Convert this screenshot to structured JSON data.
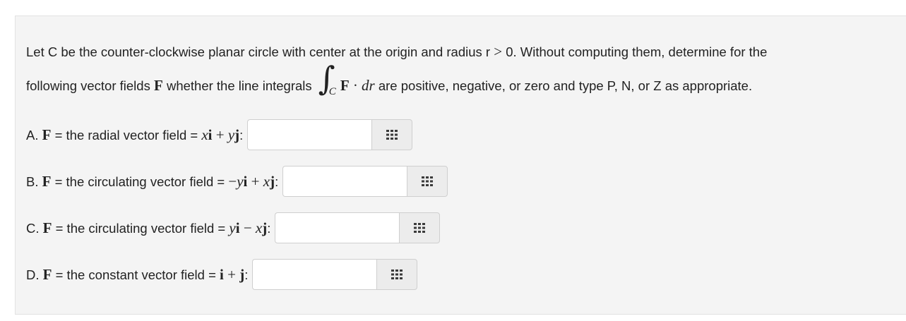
{
  "intro": {
    "line1_text": "Let C be the counter-clockwise planar circle with center at the origin and radius r",
    "line1_gt": ">",
    "line1_rest": "0. Without computing them, determine for the",
    "line2_pre": "following vector fields",
    "line2_F": "F",
    "line2_mid": "whether the line integrals",
    "integral_sub": "C",
    "integrand_F": "F",
    "integrand_dot": "·",
    "integrand_dr": "dr",
    "line2_post": "are positive, negative, or zero and type P, N, or Z as appropriate."
  },
  "questions": [
    {
      "letter": "A.",
      "F": "F",
      "text": "= the radial vector field =",
      "expr": "xi + yj",
      "colon": ":",
      "value": ""
    },
    {
      "letter": "B.",
      "F": "F",
      "text": "= the circulating vector field =",
      "expr": "−yi + xj",
      "colon": ":",
      "value": ""
    },
    {
      "letter": "C.",
      "F": "F",
      "text": "= the circulating vector field =",
      "expr": "yi − xj",
      "colon": ":",
      "value": ""
    },
    {
      "letter": "D.",
      "F": "F",
      "text": "= the constant vector field =",
      "expr": "i + j",
      "colon": ":",
      "value": ""
    }
  ],
  "icons": {
    "matrix_button": "grid-icon"
  },
  "colors": {
    "panel_bg": "#f4f4f4",
    "input_border": "#cfcfcf",
    "button_bg": "#ececec"
  }
}
